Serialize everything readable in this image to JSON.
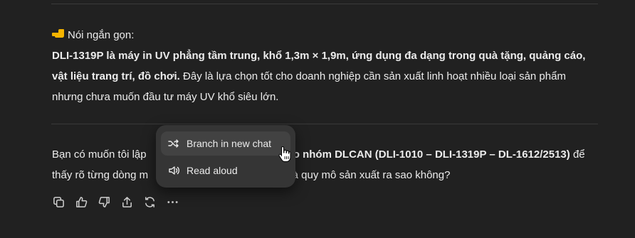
{
  "summary": {
    "lead_icon": "pointing-hand-emoji",
    "lead_label": "Nói ngắn gọn:",
    "bold_line1": "DLI-1319P là máy in UV phẳng tầm trung, khổ 1,3m × 1,9m, ứng dụng đa dạng trong quà tặng, quảng cáo,",
    "bold_line2": "vật liệu trang trí, đồ chơi.",
    "normal_line2": " Đây là lựa chọn tốt cho doanh nghiệp cần sản xuất linh hoạt nhiều loại sản phẩm",
    "line3": "nhưng chưa muốn đầu tư máy UV khổ siêu lớn."
  },
  "question": {
    "line1_start": "Bạn có muốn tôi lập",
    "line1_bold": "ho nhóm DLCAN (DLI-1010 – DLI-1319P – DL-1612/2513)",
    "line1_end": " để",
    "line2_start": "thấy rõ từng dòng m",
    "line2_end": "và quy mô sản xuất ra sao không?"
  },
  "context_menu": {
    "items": [
      {
        "label": "Branch in new chat",
        "icon": "branch-icon"
      },
      {
        "label": "Read aloud",
        "icon": "speaker-icon"
      }
    ]
  },
  "action_bar": {
    "buttons": [
      "copy-icon",
      "thumbs-up-icon",
      "thumbs-down-icon",
      "share-icon",
      "regenerate-icon",
      "more-icon"
    ]
  }
}
